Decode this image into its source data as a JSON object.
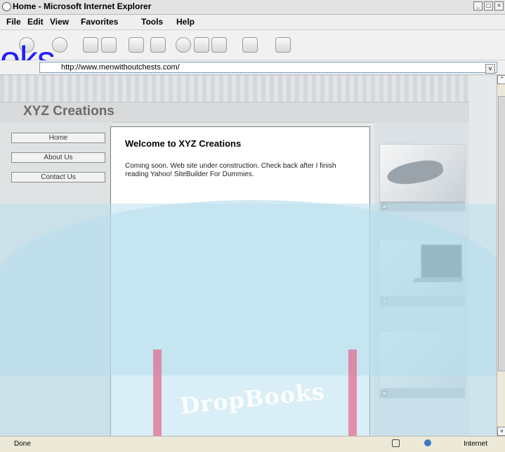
{
  "window": {
    "title": "Home - Microsoft Internet Explorer",
    "window_buttons": [
      "_",
      "□",
      "×"
    ]
  },
  "menu": [
    "File",
    "Edit",
    "View",
    "Favorites",
    "Tools",
    "Help"
  ],
  "toolbar": {
    "icons": [
      "back-icon",
      "forward-icon",
      "stop-icon",
      "refresh-icon",
      "home-icon",
      "print-icon",
      "history-icon",
      "favorites-icon",
      "media-icon",
      "edit-icon",
      "messenger-icon"
    ]
  },
  "address": {
    "url": "http://www.menwithoutchests.com/"
  },
  "watermark": {
    "top_text": "oks",
    "bottom_text": "DropBooks"
  },
  "site": {
    "name": "XYZ Creations",
    "nav": [
      "Home",
      "About Us",
      "Contact Us"
    ],
    "content": {
      "title": "Welcome to XYZ Creations",
      "body": "Coming soon. Web site under construction. Check back after I finish reading Yahoo! SiteBuilder For Dummies."
    },
    "photo_cards": [
      {
        "subject": "handshake"
      },
      {
        "subject": "laptop"
      },
      {
        "subject": "blank"
      }
    ]
  },
  "status": {
    "left": "Done",
    "right": "Internet"
  }
}
